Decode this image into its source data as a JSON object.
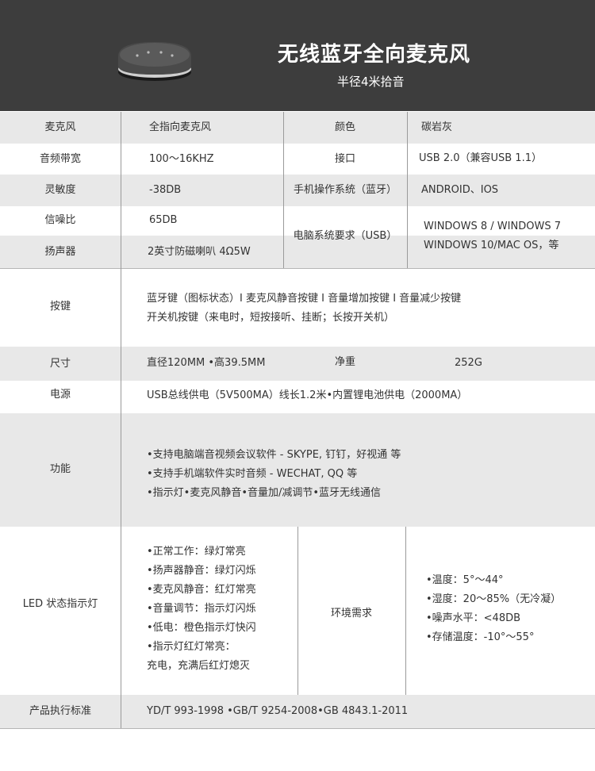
{
  "header": {
    "title": "无线蓝牙全向麦克风",
    "subtitle": "半径4米拾音"
  },
  "rows": {
    "mic_label": "麦克风",
    "mic_value": "全指向麦克风",
    "color_label": "颜色",
    "color_value": "碳岩灰",
    "band_label": "音频带宽",
    "band_value": "100～16KHZ",
    "port_label": "接口",
    "port_value": "USB 2.0（兼容USB 1.1）",
    "sens_label": "灵敏度",
    "sens_value": "-38DB",
    "phone_os_label": "手机操作系统（蓝牙）",
    "phone_os_value": "ANDROID、IOS",
    "snr_label": "信噪比",
    "snr_value": "65DB",
    "pc_req_label": "电脑系统要求（USB）",
    "pc_req_value_1": "WINDOWS 8 / WINDOWS 7",
    "pc_req_value_2": "WINDOWS 10/MAC OS，等",
    "speaker_label": "扬声器",
    "speaker_value": "2英寸防磁喇叭 4Ω5W",
    "keys_label": "按键",
    "keys_line1": "蓝牙键（图标状态）I 麦克风静音按键 I 音量增加按键 I 音量减少按键",
    "keys_line2": "开关机按键（来电时，短按接听、挂断；长按开关机）",
    "size_label": "尺寸",
    "size_value": "直径120MM •高39.5MM",
    "weight_label": "净重",
    "weight_value": "252G",
    "power_label": "电源",
    "power_value": "USB总线供电（5V500MA）线长1.2米•内置锂电池供电（2000MA）",
    "func_label": "功能",
    "func_lines": [
      "•支持电脑端音视频会议软件 - SKYPE, 钉钉，好视通 等",
      "•支持手机端软件实时音频 - WECHAT, QQ 等",
      "•指示灯•麦克风静音•音量加/减调节•蓝牙无线通信"
    ],
    "led_label": "LED 状态指示灯",
    "led_lines": [
      "•正常工作：绿灯常亮",
      "•扬声器静音：绿灯闪烁",
      "•麦克风静音：红灯常亮",
      "•音量调节：指示灯闪烁",
      "•低电：橙色指示灯快闪",
      "•指示灯红灯常亮：",
      "充电，充满后红灯熄灭"
    ],
    "env_label": "环境需求",
    "env_lines": [
      "•温度：5°～44°",
      "•湿度：20～85%（无冷凝）",
      "•噪声水平：<48DB",
      "•存储温度：-10°～55°"
    ],
    "std_label": "产品执行标准",
    "std_value": "YD/T 993-1998 •GB/T 9254-2008•GB 4843.1-2011"
  }
}
